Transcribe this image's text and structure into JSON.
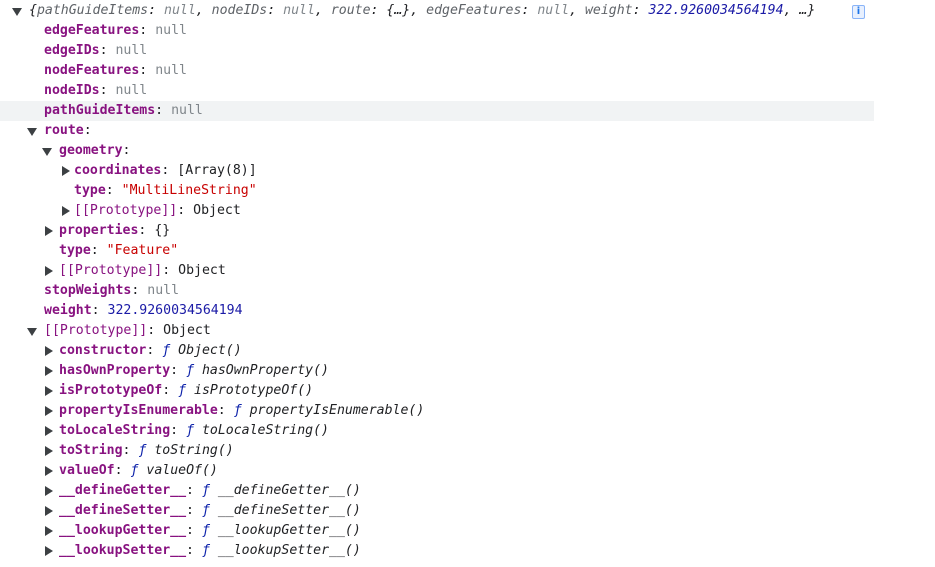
{
  "summary": {
    "open_brace": "{",
    "parts": [
      {
        "key": "pathGuideItems",
        "value": "null",
        "kind": "null"
      },
      {
        "key": "nodeIDs",
        "value": "null",
        "kind": "null"
      },
      {
        "key": "route",
        "value": "{…}",
        "kind": "obj"
      },
      {
        "key": "edgeFeatures",
        "value": "null",
        "kind": "null"
      },
      {
        "key": "weight",
        "value": "322.9260034564194",
        "kind": "num"
      }
    ],
    "tail": ", …}",
    "info_label": "i"
  },
  "rows": [
    {
      "indent": 1,
      "key": "edgeFeatures",
      "value": "null",
      "kind": "null"
    },
    {
      "indent": 1,
      "key": "edgeIDs",
      "value": "null",
      "kind": "null"
    },
    {
      "indent": 1,
      "key": "nodeFeatures",
      "value": "null",
      "kind": "null"
    },
    {
      "indent": 1,
      "key": "nodeIDs",
      "value": "null",
      "kind": "null"
    },
    {
      "indent": 1,
      "key": "pathGuideItems",
      "value": "null",
      "kind": "null",
      "highlight": true
    },
    {
      "indent": 1,
      "key": "route",
      "value": "",
      "kind": "none",
      "arrow": "down"
    },
    {
      "indent": 2,
      "key": "geometry",
      "value": "",
      "kind": "none",
      "arrow": "down"
    },
    {
      "indent": 3,
      "key": "coordinates",
      "value": "[Array(8)]",
      "kind": "obj",
      "arrow": "right"
    },
    {
      "indent": 3,
      "key": "type",
      "value": "\"MultiLineString\"",
      "kind": "str"
    },
    {
      "indent": 3,
      "key": "[[Prototype]]",
      "value": "Object",
      "kind": "obj",
      "arrow": "right",
      "proto": true
    },
    {
      "indent": 2,
      "key": "properties",
      "value": "{}",
      "kind": "obj",
      "arrow": "right"
    },
    {
      "indent": 2,
      "key": "type",
      "value": "\"Feature\"",
      "kind": "str"
    },
    {
      "indent": 2,
      "key": "[[Prototype]]",
      "value": "Object",
      "kind": "obj",
      "arrow": "right",
      "proto": true
    },
    {
      "indent": 1,
      "key": "stopWeights",
      "value": "null",
      "kind": "null"
    },
    {
      "indent": 1,
      "key": "weight",
      "value": "322.9260034564194",
      "kind": "num"
    },
    {
      "indent": 1,
      "key": "[[Prototype]]",
      "value": "Object",
      "kind": "obj",
      "arrow": "down",
      "proto": true
    },
    {
      "indent": 2,
      "key": "constructor",
      "fn": "Object()",
      "kind": "fn",
      "arrow": "right"
    },
    {
      "indent": 2,
      "key": "hasOwnProperty",
      "fn": "hasOwnProperty()",
      "kind": "fn",
      "arrow": "right"
    },
    {
      "indent": 2,
      "key": "isPrototypeOf",
      "fn": "isPrototypeOf()",
      "kind": "fn",
      "arrow": "right"
    },
    {
      "indent": 2,
      "key": "propertyIsEnumerable",
      "fn": "propertyIsEnumerable()",
      "kind": "fn",
      "arrow": "right"
    },
    {
      "indent": 2,
      "key": "toLocaleString",
      "fn": "toLocaleString()",
      "kind": "fn",
      "arrow": "right"
    },
    {
      "indent": 2,
      "key": "toString",
      "fn": "toString()",
      "kind": "fn",
      "arrow": "right"
    },
    {
      "indent": 2,
      "key": "valueOf",
      "fn": "valueOf()",
      "kind": "fn",
      "arrow": "right"
    },
    {
      "indent": 2,
      "key": "__defineGetter__",
      "fn": "__defineGetter__()",
      "kind": "fn",
      "arrow": "right"
    },
    {
      "indent": 2,
      "key": "__defineSetter__",
      "fn": "__defineSetter__()",
      "kind": "fn",
      "arrow": "right"
    },
    {
      "indent": 2,
      "key": "__lookupGetter__",
      "fn": "__lookupGetter__()",
      "kind": "fn",
      "arrow": "right"
    },
    {
      "indent": 2,
      "key": "__lookupSetter__",
      "fn": "__lookupSetter__()",
      "kind": "fn",
      "arrow": "right"
    }
  ],
  "fn_glyph": "ƒ",
  "colon": ":"
}
